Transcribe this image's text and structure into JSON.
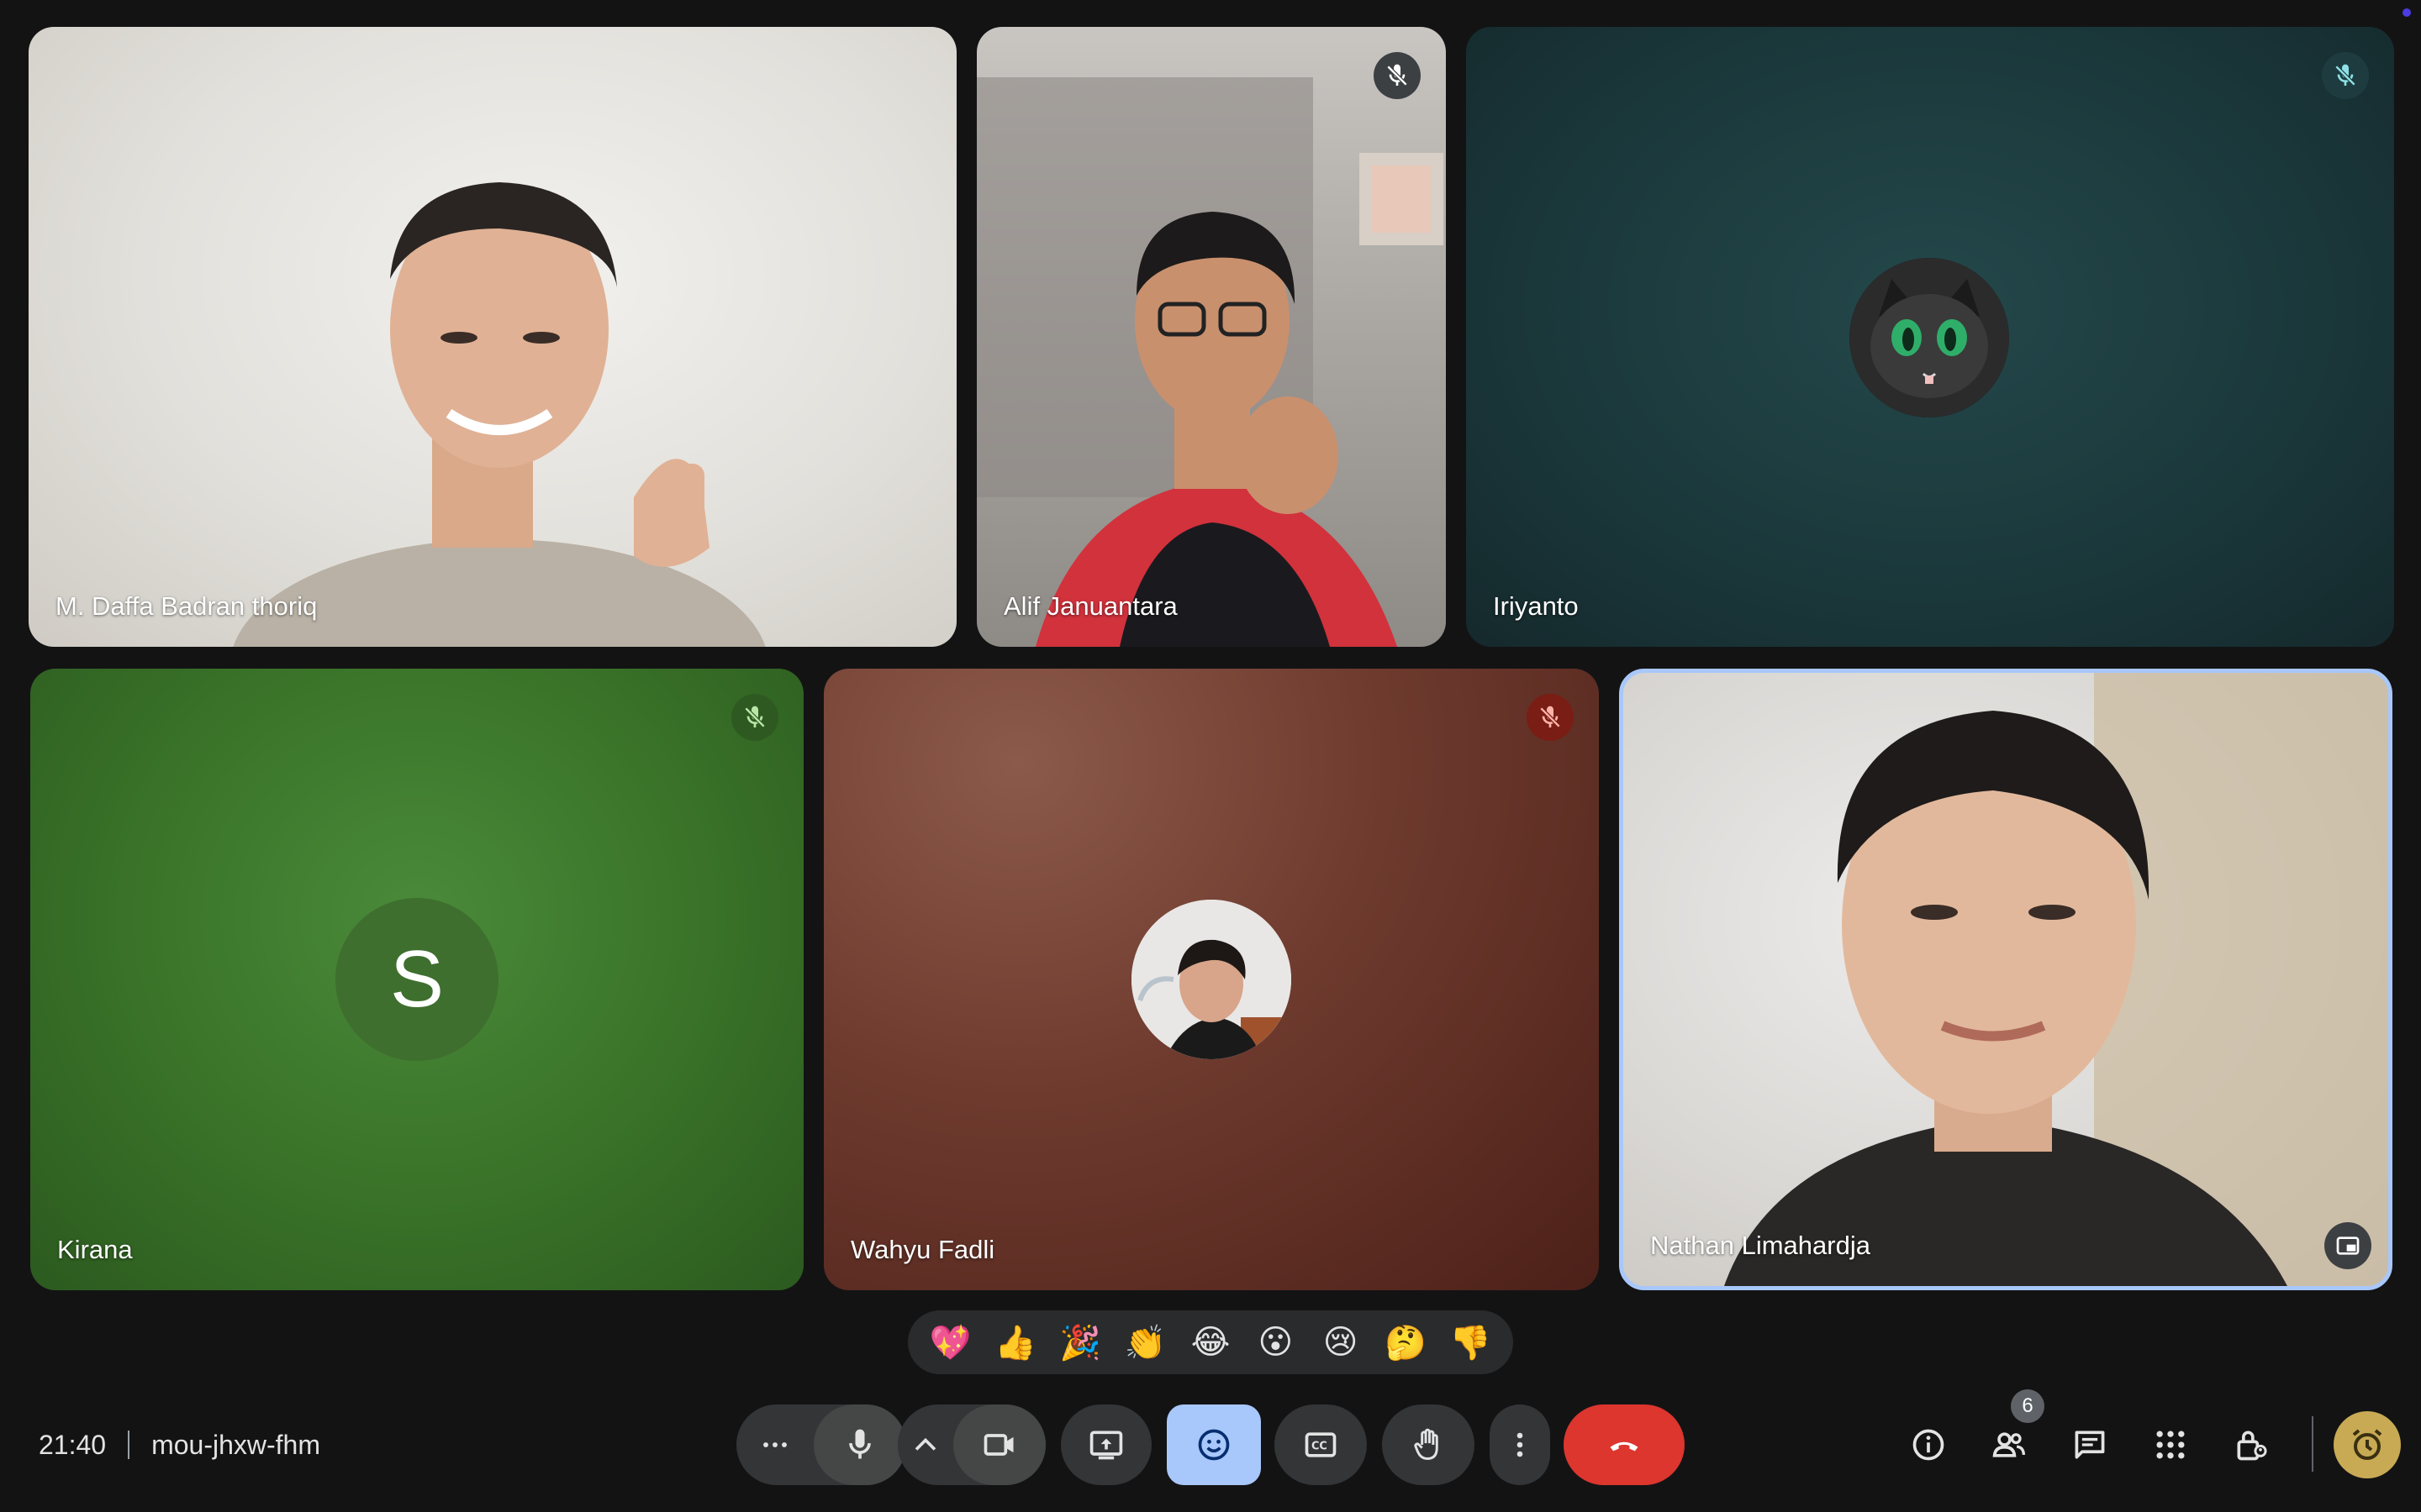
{
  "participants": [
    {
      "name": "M. Daffa Badran thoriq",
      "muted": false
    },
    {
      "name": "Alif Januantara",
      "muted": true
    },
    {
      "name": "Iriyanto",
      "muted": true
    },
    {
      "name": "Kirana",
      "muted": true,
      "avatar_initial": "S"
    },
    {
      "name": "Wahyu Fadli",
      "muted": true
    },
    {
      "name": "Nathan Limahardja",
      "muted": false,
      "active_speaker": true
    }
  ],
  "reactions": [
    "💖",
    "👍",
    "🎉",
    "👏",
    "😂",
    "😮",
    "😢",
    "🤔",
    "👎"
  ],
  "meeting": {
    "time": "21:40",
    "code": "mou-jhxw-fhm"
  },
  "people_count": "6",
  "colors": {
    "background": "#131314",
    "control": "#333537",
    "control_active": "#a8c7fa",
    "end_call": "#dc362e",
    "active_border": "#a8c7fa"
  }
}
